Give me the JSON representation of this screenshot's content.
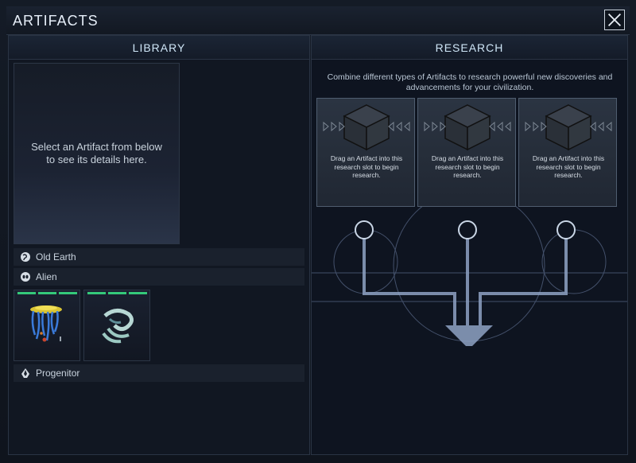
{
  "window": {
    "title": "ARTIFACTS",
    "close_icon": "close-icon"
  },
  "library": {
    "header": "LIBRARY",
    "details_placeholder": "Select an Artifact from below to see its details here.",
    "categories": [
      {
        "label": "Old Earth",
        "icon": "globe-icon"
      },
      {
        "label": "Alien",
        "icon": "alien-icon"
      },
      {
        "label": "Progenitor",
        "icon": "progenitor-icon"
      }
    ],
    "artifacts": [
      {
        "name": "alien-artifact-jellyfish",
        "icon": "jellyfish-icon",
        "level_bars": 3
      },
      {
        "name": "alien-artifact-tentacle",
        "icon": "tentacle-icon",
        "level_bars": 3
      }
    ]
  },
  "research": {
    "header": "RESEARCH",
    "description": "Combine different types of Artifacts to research powerful new discoveries and advancements for your civilization.",
    "slots": [
      {
        "text": "Drag an Artifact into this research slot to begin research."
      },
      {
        "text": "Drag an Artifact into this research slot to begin research."
      },
      {
        "text": "Drag an Artifact into this research slot to begin research."
      }
    ]
  },
  "colors": {
    "accent": "#34c97a",
    "text": "#c9d3de",
    "circuit": "#8ea2c4"
  }
}
